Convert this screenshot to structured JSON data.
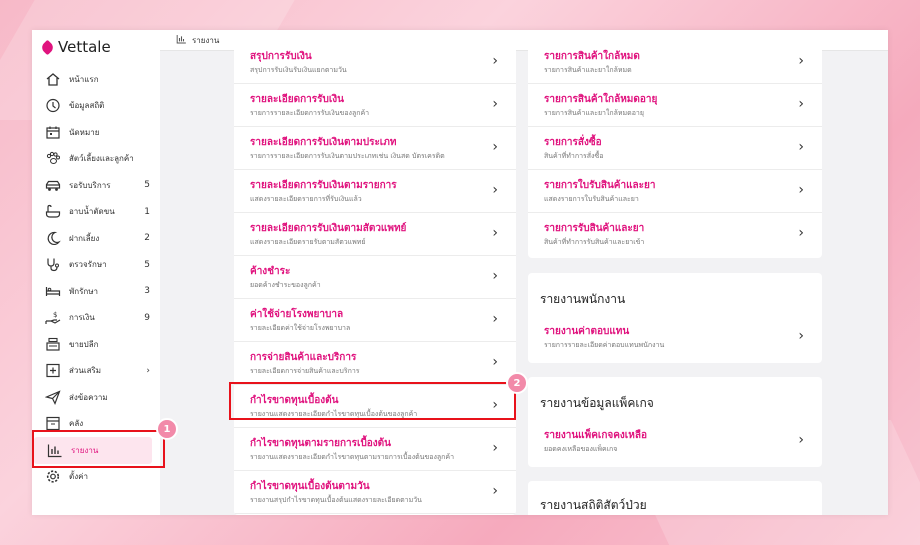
{
  "app": {
    "brand": "Vettale"
  },
  "sidebar": {
    "items": [
      {
        "icon": "home-icon",
        "label": "หน้าแรก",
        "count": ""
      },
      {
        "icon": "stats-icon",
        "label": "ข้อมูลสถิติ",
        "count": ""
      },
      {
        "icon": "calendar-icon",
        "label": "นัดหมาย",
        "count": ""
      },
      {
        "icon": "paw-icon",
        "label": "สัตว์เลี้ยงและลูกค้า",
        "count": ""
      },
      {
        "icon": "car-icon",
        "label": "รอรับบริการ",
        "count": "5"
      },
      {
        "icon": "bath-icon",
        "label": "อาบน้ำตัดขน",
        "count": "1"
      },
      {
        "icon": "moon-icon",
        "label": "ฝากเลี้ยง",
        "count": "2"
      },
      {
        "icon": "stethoscope-icon",
        "label": "ตรวจรักษา",
        "count": "5"
      },
      {
        "icon": "bed-icon",
        "label": "พักรักษา",
        "count": "3"
      },
      {
        "icon": "money-hand-icon",
        "label": "การเงิน",
        "count": "9"
      },
      {
        "icon": "cashier-icon",
        "label": "ขายปลีก",
        "count": ""
      },
      {
        "icon": "plus-box-icon",
        "label": "ส่วนเสริม",
        "count": "›"
      },
      {
        "icon": "send-icon",
        "label": "ส่งข้อความ",
        "count": ""
      },
      {
        "icon": "storage-icon",
        "label": "คลัง",
        "count": ""
      },
      {
        "icon": "report-chart-icon",
        "label": "รายงาน",
        "count": ""
      },
      {
        "icon": "gear-icon",
        "label": "ตั้งค่า",
        "count": ""
      }
    ]
  },
  "header": {
    "breadcrumb_icon": "report-chart-icon",
    "breadcrumb": "รายงาน"
  },
  "annotations": {
    "badge1": "1",
    "badge2": "2"
  },
  "left_card": {
    "rows": [
      {
        "title": "สรุปการรับเงิน",
        "sub": "สรุปการรับเงินรับเงินแยกตามวัน"
      },
      {
        "title": "รายละเอียดการรับเงิน",
        "sub": "รายการรายละเอียดการรับเงินของลูกค้า"
      },
      {
        "title": "รายละเอียดการรับเงินตามประเภท",
        "sub": "รายการรายละเอียดการรับเงินตามประเภทเช่น เงินสด บัตรเครดิต"
      },
      {
        "title": "รายละเอียดการรับเงินตามรายการ",
        "sub": "แสดงรายละเอียดรายการที่รับเงินแล้ว"
      },
      {
        "title": "รายละเอียดการรับเงินตามสัตวแพทย์",
        "sub": "แสดงรายละเอียดรายรับตามสัตวแพทย์"
      },
      {
        "title": "ค้างชำระ",
        "sub": "ยอดค้างชำระของลูกค้า"
      },
      {
        "title": "ค่าใช้จ่ายโรงพยาบาล",
        "sub": "รายละเอียดค่าใช้จ่ายโรงพยาบาล"
      },
      {
        "title": "การจ่ายสินค้าและบริการ",
        "sub": "รายละเอียดการจ่ายสินค้าและบริการ"
      },
      {
        "title": "กำไรขาดทุนเบื้องต้น",
        "sub": "รายงานแสดงรายละเอียดกำไรขาดทุนเบื้องต้นของลูกค้า"
      },
      {
        "title": "กำไรขาดทุนตามรายการเบื้องต้น",
        "sub": "รายงานแสดงรายละเอียดกำไรขาดทุนตามรายการเบื้องต้นของลูกค้า"
      },
      {
        "title": "กำไรขาดทุนเบื้องต้นตามวัน",
        "sub": "รายงานสรุปกำไรขาดทุนเบื้องต้นแสดงรายละเอียดตามวัน"
      }
    ]
  },
  "right_card1": {
    "rows": [
      {
        "title": "รายการสินค้าใกล้หมด",
        "sub": "รายการสินค้าและยาใกล้หมด"
      },
      {
        "title": "รายการสินค้าใกล้หมดอายุ",
        "sub": "รายการสินค้าและยาใกล้หมดอายุ"
      },
      {
        "title": "รายการสั่งซื้อ",
        "sub": "สินค้าที่ทำการสั่งซื้อ"
      },
      {
        "title": "รายการใบรับสินค้าและยา",
        "sub": "แสดงรายการใบรับสินค้าและยา"
      },
      {
        "title": "รายการรับสินค้าและยา",
        "sub": "สินค้าที่ทำการรับสินค้าและยาเข้า"
      }
    ]
  },
  "staff_card": {
    "heading": "รายงานพนักงาน",
    "rows": [
      {
        "title": "รายงานค่าตอบแทน",
        "sub": "รายการรายละเอียดค่าตอบแทนพนักงาน"
      }
    ]
  },
  "package_card": {
    "heading": "รายงานข้อมูลแพ็คเกจ",
    "rows": [
      {
        "title": "รายงานแพ็คเกจคงเหลือ",
        "sub": "ยอดคงเหลือของแพ็คเกจ"
      }
    ]
  },
  "sick_card": {
    "heading": "รายงานสถิติสัตว์ป่วย"
  },
  "colors": {
    "accent": "#e0137e",
    "highlight": "#e8121b",
    "badge": "#f28aa9"
  }
}
